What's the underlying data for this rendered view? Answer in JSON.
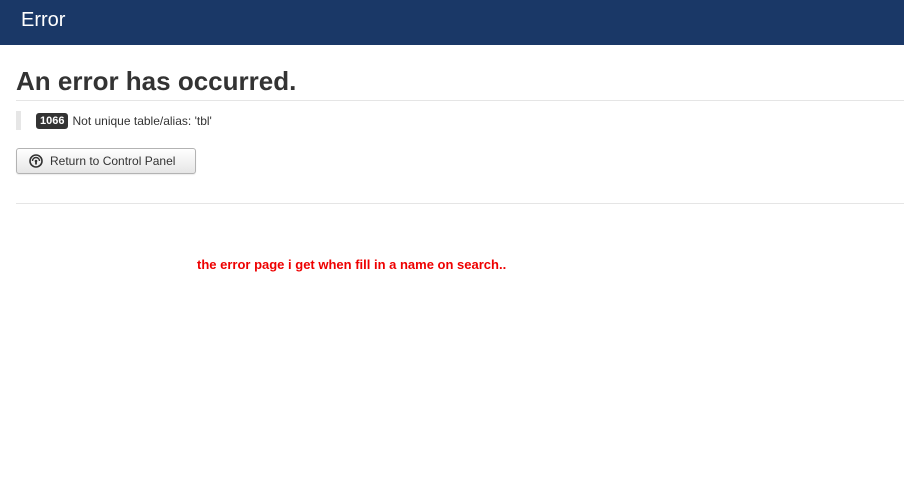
{
  "header": {
    "title": "Error",
    "background_color": "#1a3867"
  },
  "main": {
    "heading": "An error has occurred.",
    "error": {
      "code": "1066",
      "message": "Not unique table/alias: 'tbl'"
    },
    "return_button": {
      "label": "Return to Control Panel",
      "icon": "dashboard-icon"
    }
  },
  "annotation": {
    "text": "the error page i get when fill in a name on search..",
    "color": "#ee0000"
  }
}
